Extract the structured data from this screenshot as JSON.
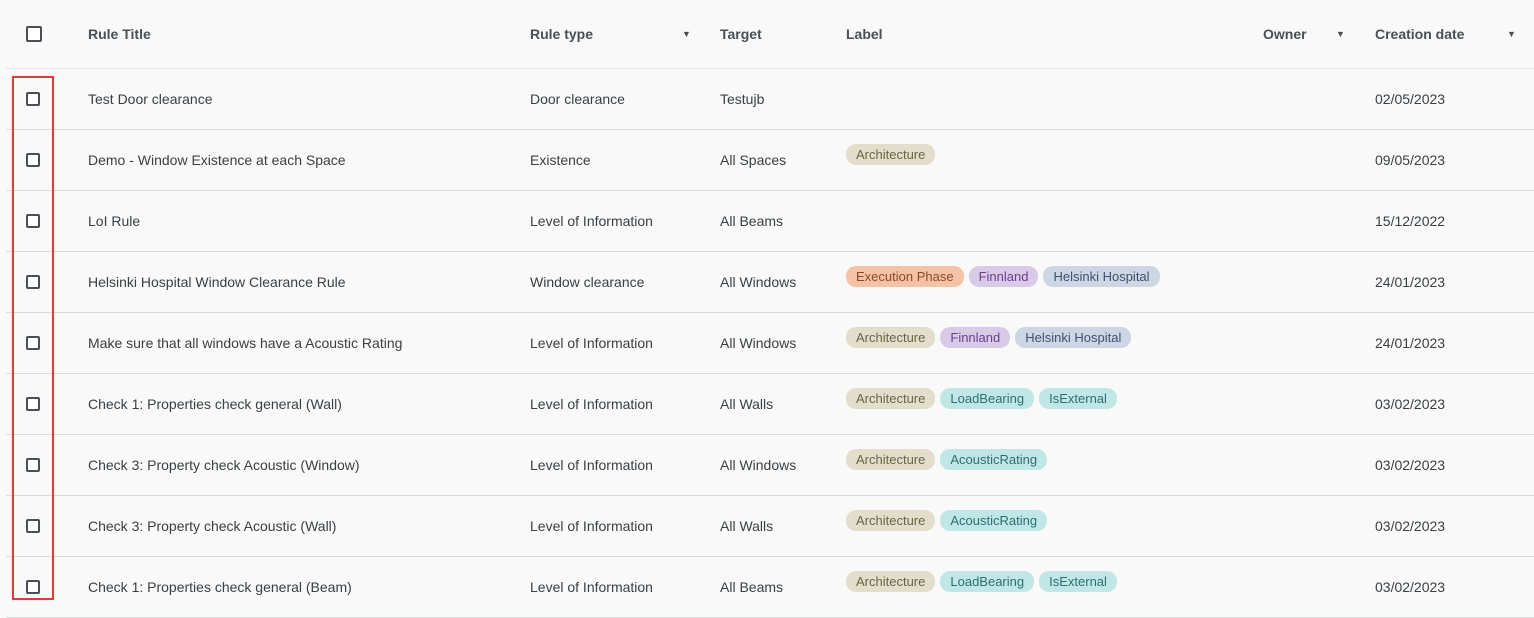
{
  "header": {
    "title": "Rule Title",
    "type": "Rule type",
    "target": "Target",
    "label": "Label",
    "owner": "Owner",
    "date": "Creation date"
  },
  "sort_icon": "caret-down-icon",
  "tag_colors": {
    "Architecture": {
      "bg": "#e2decb",
      "fg": "#6b6545"
    },
    "Execution Phase": {
      "bg": "#f6c2a6",
      "fg": "#8a4a2a"
    },
    "Finnland": {
      "bg": "#d9cbe8",
      "fg": "#6b3f8f"
    },
    "Helsinki Hospital": {
      "bg": "#cdd6e4",
      "fg": "#3f5070"
    },
    "LoadBearing": {
      "bg": "#c0e6e6",
      "fg": "#2e7070"
    },
    "IsExternal": {
      "bg": "#c0e6e6",
      "fg": "#2e7070"
    },
    "AcousticRating": {
      "bg": "#c0e6e6",
      "fg": "#2e7070"
    }
  },
  "rows": [
    {
      "title": "Test Door clearance",
      "type": "Door clearance",
      "target": "Testujb",
      "labels": [],
      "owner": "",
      "date": "02/05/2023"
    },
    {
      "title": "Demo - Window Existence at each Space",
      "type": "Existence",
      "target": "All Spaces",
      "labels": [
        "Architecture"
      ],
      "owner": "",
      "date": "09/05/2023"
    },
    {
      "title": "LoI Rule",
      "type": "Level of Information",
      "target": "All Beams",
      "labels": [],
      "owner": "",
      "date": "15/12/2022"
    },
    {
      "title": "Helsinki Hospital Window Clearance Rule",
      "type": "Window clearance",
      "target": "All Windows",
      "labels": [
        "Execution Phase",
        "Finnland",
        "Helsinki Hospital"
      ],
      "owner": "",
      "date": "24/01/2023"
    },
    {
      "title": "Make sure that all windows have a Acoustic Rating",
      "type": "Level of Information",
      "target": "All Windows",
      "labels": [
        "Architecture",
        "Finnland",
        "Helsinki Hospital"
      ],
      "owner": "",
      "date": "24/01/2023"
    },
    {
      "title": "Check 1: Properties check general (Wall)",
      "type": "Level of Information",
      "target": "All Walls",
      "labels": [
        "Architecture",
        "LoadBearing",
        "IsExternal"
      ],
      "owner": "",
      "date": "03/02/2023"
    },
    {
      "title": "Check 3: Property check Acoustic (Window)",
      "type": "Level of Information",
      "target": "All Windows",
      "labels": [
        "Architecture",
        "AcousticRating"
      ],
      "owner": "",
      "date": "03/02/2023"
    },
    {
      "title": "Check 3: Property check Acoustic (Wall)",
      "type": "Level of Information",
      "target": "All Walls",
      "labels": [
        "Architecture",
        "AcousticRating"
      ],
      "owner": "",
      "date": "03/02/2023"
    },
    {
      "title": "Check 1: Properties check general (Beam)",
      "type": "Level of Information",
      "target": "All Beams",
      "labels": [
        "Architecture",
        "LoadBearing",
        "IsExternal"
      ],
      "owner": "",
      "date": "03/02/2023"
    }
  ]
}
